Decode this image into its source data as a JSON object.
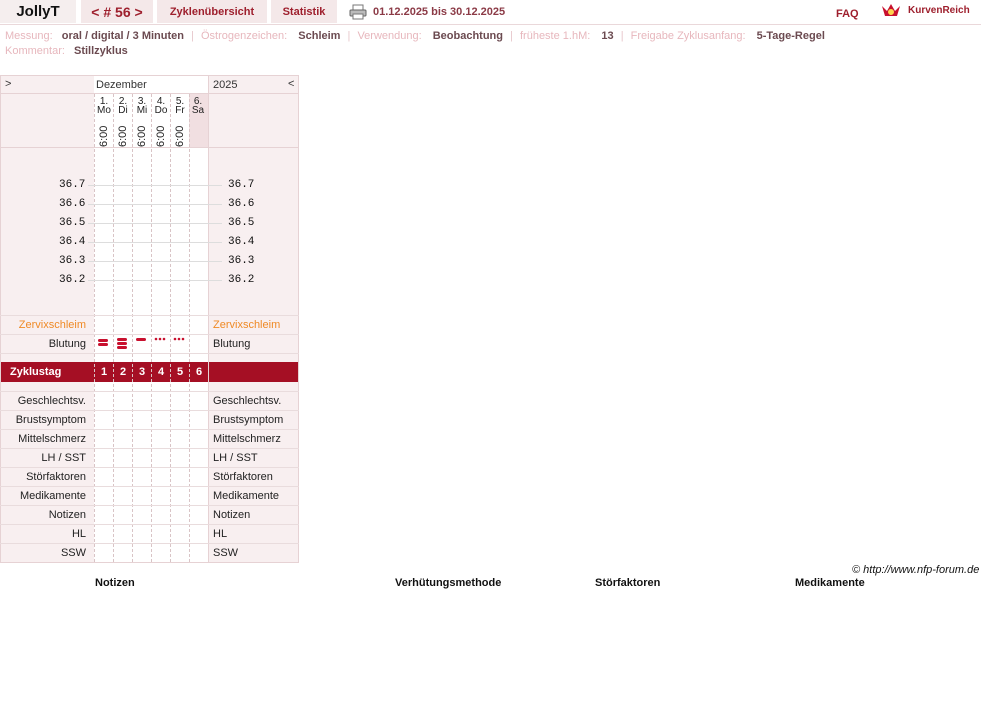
{
  "header": {
    "user": "JollyT",
    "cycle_nav": "< # 56 >",
    "tabs": [
      "Zyklenübersicht",
      "Statistik"
    ],
    "date_range": "01.12.2025 bis 30.12.2025",
    "faq": "FAQ",
    "brand": "KurvenReich"
  },
  "info": {
    "messung_label": "Messung:",
    "messung_value": "oral / digital / 3 Minuten",
    "oestrogen_label": "Östrogenzeichen:",
    "oestrogen_value": "Schleim",
    "verwendung_label": "Verwendung:",
    "verwendung_value": "Beobachtung",
    "fruehste_label": "früheste 1.hM:",
    "fruehste_value": "13",
    "freigabe_label": "Freigabe Zyklusanfang:",
    "freigabe_value": "5-Tage-Regel",
    "kommentar_label": "Kommentar:",
    "kommentar_value": "Stillzyklus"
  },
  "chart": {
    "nav_prev": ">",
    "nav_next": "<",
    "month": "Dezember",
    "year": "2025",
    "days": [
      {
        "num": "1.",
        "wd": "Mo",
        "time": "6:00"
      },
      {
        "num": "2.",
        "wd": "Di",
        "time": "6:00"
      },
      {
        "num": "3.",
        "wd": "Mi",
        "time": "6:00"
      },
      {
        "num": "4.",
        "wd": "Do",
        "time": "6:00"
      },
      {
        "num": "5.",
        "wd": "Fr",
        "time": "6:00"
      },
      {
        "num": "6.",
        "wd": "Sa",
        "time": ""
      }
    ],
    "temp_ticks": [
      "36.7",
      "36.6",
      "36.5",
      "36.4",
      "36.3",
      "36.2"
    ],
    "zervix_label": "Zervixschleim",
    "blutung_label": "Blutung",
    "blutung_levels": [
      "stark",
      "sehr stark",
      "mittel",
      "schwach",
      "schwach"
    ],
    "zyklustag_label": "Zyklustag",
    "zyklustage": [
      "1",
      "2",
      "3",
      "4",
      "5",
      "6"
    ],
    "symptom_rows": [
      "Geschlechtsv.",
      "Brustsymptom",
      "Mittelschmerz",
      "LH / SST",
      "Störfaktoren",
      "Medikamente",
      "Notizen",
      "HL",
      "SSW"
    ],
    "accent_color": "#a50f24",
    "bleeding_color": "#c8102e"
  },
  "footer": {
    "credit": "© http://www.nfp-forum.de",
    "headers": [
      "Notizen",
      "Verhütungsmethode",
      "Störfaktoren",
      "Medikamente"
    ]
  }
}
